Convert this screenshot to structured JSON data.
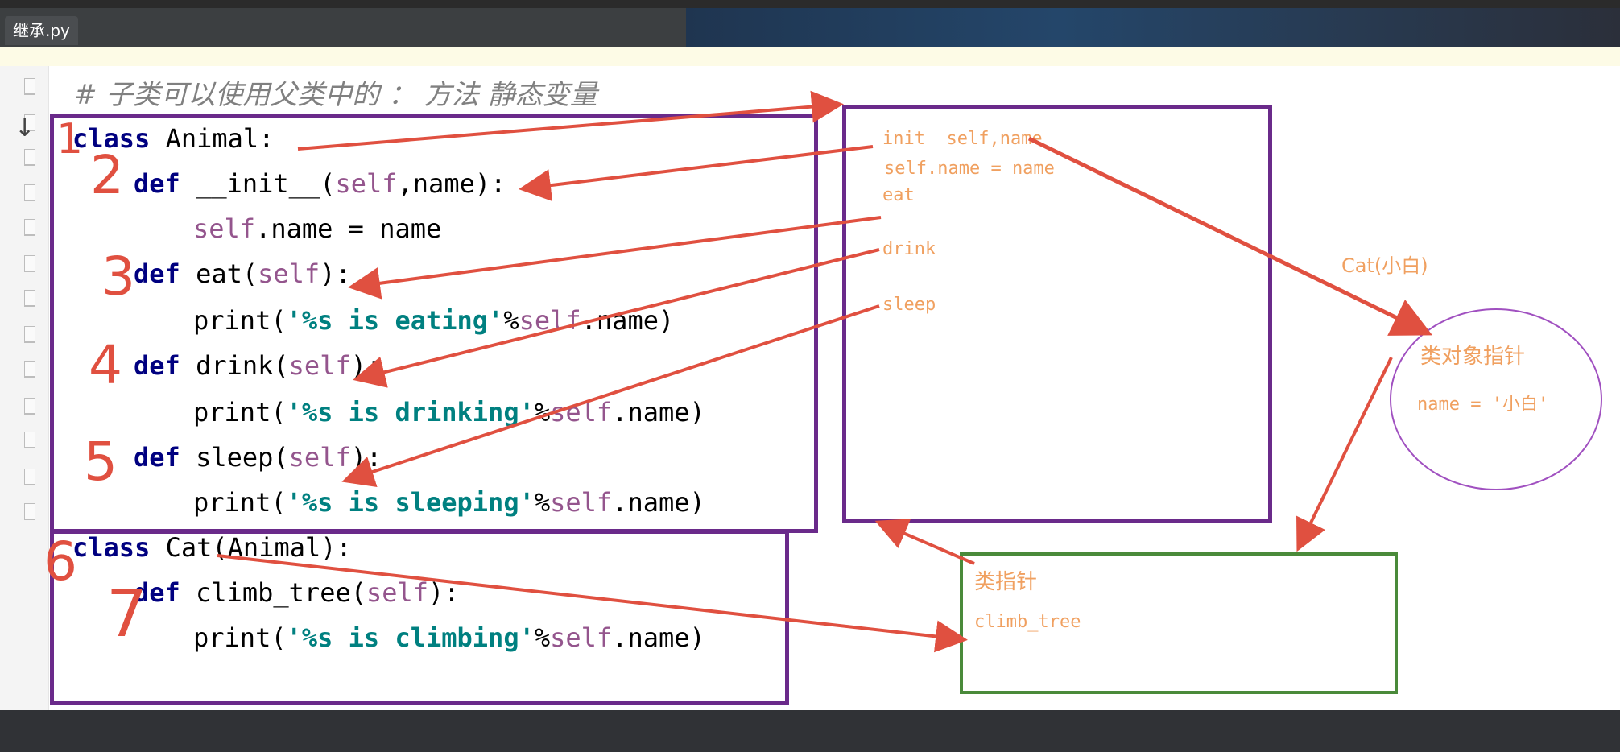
{
  "editor": {
    "tab_label": "继承.py",
    "comment": "# 子类可以使用父类中的 ： 方法 静态变量",
    "code_lines": [
      {
        "kw": "class ",
        "rest": "Animal:"
      },
      {
        "kw": "def ",
        "name": "__init__",
        "open": "(",
        "self": "self",
        "rest": ",name):"
      },
      {
        "self": "self",
        "rest": ".name = name"
      },
      {
        "kw": "def ",
        "name": "eat",
        "open": "(",
        "self": "self",
        "rest": "):"
      },
      {
        "fn": "print(",
        "str": "'%s is eating'",
        "pct": "%",
        "self": "self",
        "rest": ".name)"
      },
      {
        "kw": "def ",
        "name": "drink",
        "open": "(",
        "self": "self",
        "rest": "):"
      },
      {
        "fn": "print(",
        "str": "'%s is drinking'",
        "pct": "%",
        "self": "self",
        "rest": ".name)"
      },
      {
        "kw": "def ",
        "name": "sleep",
        "open": "(",
        "self": "self",
        "rest": "):"
      },
      {
        "fn": "print(",
        "str": "'%s is sleeping'",
        "pct": "%",
        "self": "self",
        "rest": ".name)"
      },
      {
        "kw": "class ",
        "rest": "Cat(Animal):"
      },
      {
        "kw": "def ",
        "name": "climb_tree",
        "open": "(",
        "self": "self",
        "rest": "):"
      },
      {
        "fn": "print(",
        "str": "'%s is climbing'",
        "pct": "%",
        "self": "self",
        "rest": ".name)"
      }
    ]
  },
  "annotations": {
    "numbers": [
      "1",
      "2",
      "3",
      "4",
      "5",
      "6",
      "7"
    ],
    "animal_namespace": [
      "init  self,name",
      "self.name = name",
      "eat",
      "drink",
      "sleep"
    ],
    "cat_label": "Cat(小白)",
    "object_pointer": "类对象指针",
    "object_name": "name = '小白'",
    "class_pointer": "类指针",
    "cat_namespace": "climb_tree"
  },
  "colors": {
    "purple_box": "#6a2a8a",
    "green_box": "#4a8a3a",
    "arrow_red": "#e05040",
    "annotation": "#f0a060"
  }
}
